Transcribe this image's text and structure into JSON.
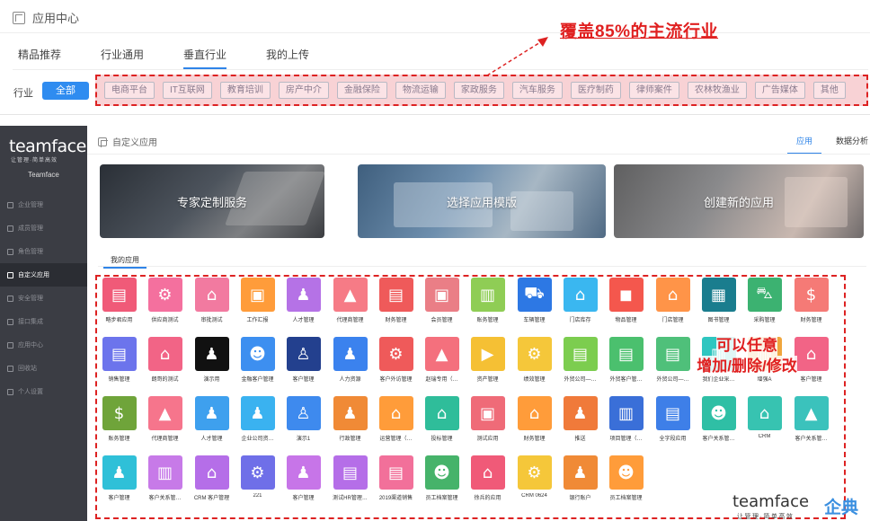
{
  "top": {
    "title": "应用中心",
    "tabs": [
      {
        "label": "精品推荐",
        "active": false
      },
      {
        "label": "行业通用",
        "active": false
      },
      {
        "label": "垂直行业",
        "active": true
      },
      {
        "label": "我的上传",
        "active": false
      }
    ],
    "industry_label": "行业",
    "all_label": "全部",
    "industries": [
      "电商平台",
      "IT互联网",
      "教育培训",
      "房产中介",
      "金融保险",
      "物流运输",
      "家政服务",
      "汽车服务",
      "医疗制药",
      "律师案件",
      "农林牧渔业",
      "广告媒体",
      "其他"
    ],
    "annotation": "覆盖85%的主流行业"
  },
  "sidebar": {
    "logo": "teamface",
    "slogan": "让管理·简单高效",
    "company": "Teamface",
    "items": [
      {
        "label": "企业管理",
        "active": false
      },
      {
        "label": "成员管理",
        "active": false
      },
      {
        "label": "角色管理",
        "active": false
      },
      {
        "label": "自定义应用",
        "active": true
      },
      {
        "label": "安全管理",
        "active": false
      },
      {
        "label": "接口集成",
        "active": false
      },
      {
        "label": "应用中心",
        "active": false
      },
      {
        "label": "回收站",
        "active": false
      },
      {
        "label": "个人设置",
        "active": false
      }
    ]
  },
  "main": {
    "title": "自定义应用",
    "tabs": [
      {
        "label": "应用",
        "active": true
      },
      {
        "label": "数据分析",
        "active": false
      }
    ],
    "banners": [
      "专家定制服务",
      "选择应用模版",
      "创建新的应用"
    ],
    "my_apps_tab": "我的应用",
    "annotation_line1": "可以任意",
    "annotation_line2": "增加/删除/修改"
  },
  "apps": [
    {
      "label": "略步君应用",
      "color": "#f05a78",
      "icon": "doc-icon"
    },
    {
      "label": "供应商测试",
      "color": "#f4709e",
      "icon": "gear-doc-icon"
    },
    {
      "label": "审批测试",
      "color": "#f27aa0",
      "icon": "store-icon"
    },
    {
      "label": "工作汇报",
      "color": "#ff9c3a",
      "icon": "box-icon"
    },
    {
      "label": "人才管理",
      "color": "#b572e6",
      "icon": "user-gear-icon"
    },
    {
      "label": "代理商管理",
      "color": "#f67b86",
      "icon": "lock-icon"
    },
    {
      "label": "财务管理",
      "color": "#ef5a5a",
      "icon": "doc-icon"
    },
    {
      "label": "会员管理",
      "color": "#ea7e86",
      "icon": "box-icon"
    },
    {
      "label": "账务管理",
      "color": "#8fcd55",
      "icon": "chart-icon"
    },
    {
      "label": "车辆管理",
      "color": "#2d78e4",
      "icon": "car-icon"
    },
    {
      "label": "门店库存",
      "color": "#3ab7f0",
      "icon": "store-icon"
    },
    {
      "label": "物品管理",
      "color": "#f4574d",
      "icon": "bag-icon"
    },
    {
      "label": "门店管理",
      "color": "#ff9448",
      "icon": "store-icon"
    },
    {
      "label": "图书管理",
      "color": "#1a7d8e",
      "icon": "book-icon"
    },
    {
      "label": "采购管理",
      "color": "#3cb271",
      "icon": "cart-icon"
    },
    {
      "label": "财务管理",
      "color": "#f57a76",
      "icon": "money-icon"
    },
    {
      "label": "销售管理",
      "color": "#6c74ec",
      "icon": "doc-icon"
    },
    {
      "label": "朗哥的测试",
      "color": "#f26486",
      "icon": "store-icon"
    },
    {
      "label": "演示用",
      "color": "#111111",
      "icon": "user-gear-icon"
    },
    {
      "label": "金融客户管理",
      "color": "#3d8ff0",
      "icon": "users-icon"
    },
    {
      "label": "客户管理",
      "color": "#23408e",
      "icon": "person-icon"
    },
    {
      "label": "人力资源",
      "color": "#3b82ee",
      "icon": "user-gear-icon"
    },
    {
      "label": "客户外访管理",
      "color": "#ef5a5a",
      "icon": "gear-doc-icon"
    },
    {
      "label": "赵瑞专用（…",
      "color": "#f4707d",
      "icon": "lock-icon"
    },
    {
      "label": "资产管理",
      "color": "#f5c034",
      "icon": "play-icon"
    },
    {
      "label": "绩效管理",
      "color": "#f5c73a",
      "icon": "gear-doc-icon"
    },
    {
      "label": "外贸公司—…",
      "color": "#7ccd4f",
      "icon": "doc-icon"
    },
    {
      "label": "外贸客户管…",
      "color": "#4bc06e",
      "icon": "doc-icon"
    },
    {
      "label": "外贸公司—…",
      "color": "#4fc07a",
      "icon": "doc-icon"
    },
    {
      "label": "我们企业采…",
      "color": "#2fc6c0",
      "icon": "chart-icon"
    },
    {
      "label": "增强A",
      "color": "#f0a63d",
      "icon": "chart-icon"
    },
    {
      "label": "客户管理",
      "color": "#f26486",
      "icon": "store-icon"
    },
    {
      "label": "账务管理",
      "color": "#6fa43a",
      "icon": "money-icon"
    },
    {
      "label": "代理商管理",
      "color": "#f6758c",
      "icon": "lock-icon"
    },
    {
      "label": "人才管理",
      "color": "#3ea0ee",
      "icon": "user-gear-icon"
    },
    {
      "label": "企业公司资…",
      "color": "#3ab2f0",
      "icon": "user-gear-icon"
    },
    {
      "label": "演示1",
      "color": "#3e8aee",
      "icon": "person-icon"
    },
    {
      "label": "行政管理",
      "color": "#f08a36",
      "icon": "user-gear-icon"
    },
    {
      "label": "运营管理（…",
      "color": "#ff9c3a",
      "icon": "store-icon"
    },
    {
      "label": "投标管理",
      "color": "#2fbd9a",
      "icon": "store-icon"
    },
    {
      "label": "测试应用",
      "color": "#ef6b78",
      "icon": "box-icon"
    },
    {
      "label": "财务管理",
      "color": "#ff9c3a",
      "icon": "store-icon"
    },
    {
      "label": "推送",
      "color": "#f07a3a",
      "icon": "user-gear-icon"
    },
    {
      "label": "项目管理（…",
      "color": "#3a6fd8",
      "icon": "chart-icon"
    },
    {
      "label": "全字段应用",
      "color": "#3e7fe8",
      "icon": "doc-icon"
    },
    {
      "label": "客户关系管…",
      "color": "#2fbfa5",
      "icon": "users-icon"
    },
    {
      "label": "CRM",
      "color": "#37c3b1",
      "icon": "store-icon"
    },
    {
      "label": "客户关系管…",
      "color": "#3bc2bc",
      "icon": "lock-icon"
    },
    {
      "label": "客户管理",
      "color": "#2fc0d8",
      "icon": "user-gear-icon"
    },
    {
      "label": "客户关系管…",
      "color": "#c77ae8",
      "icon": "chart-icon"
    },
    {
      "label": "CRM 客户管理",
      "color": "#b56ee8",
      "icon": "store-icon"
    },
    {
      "label": "221",
      "color": "#6f6fe8",
      "icon": "gear-doc-icon"
    },
    {
      "label": "客户管理",
      "color": "#c775e8",
      "icon": "user-gear-icon"
    },
    {
      "label": "测试HR管理…",
      "color": "#b56ee8",
      "icon": "doc-icon"
    },
    {
      "label": "2019渠道销售",
      "color": "#f2709a",
      "icon": "doc-icon"
    },
    {
      "label": "员工档案管理",
      "color": "#46b36a",
      "icon": "users-icon"
    },
    {
      "label": "徐兵的应用",
      "color": "#f05a78",
      "icon": "store-icon"
    },
    {
      "label": "CRM 0624",
      "color": "#f5c73a",
      "icon": "gear-doc-icon"
    },
    {
      "label": "银行账户",
      "color": "#f08a36",
      "icon": "user-gear-icon"
    },
    {
      "label": "员工档案管理",
      "color": "#ff9c3a",
      "icon": "users-icon"
    }
  ],
  "watermark": {
    "brand": "teamface",
    "cn": "企典",
    "sub": "让管理·简单高效"
  },
  "colors": {
    "accent": "#2f84e8",
    "annotation": "#e02020",
    "sidebar": "#3b3d44"
  }
}
